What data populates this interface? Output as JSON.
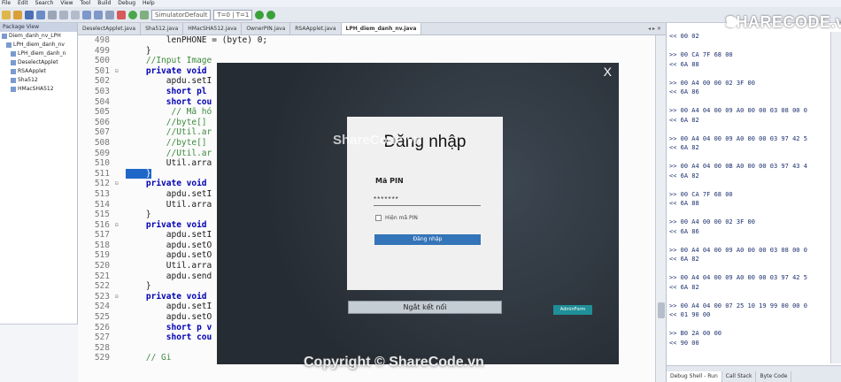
{
  "menu": [
    "File",
    "Edit",
    "Search",
    "View",
    "Tool",
    "Build",
    "Debug",
    "Help"
  ],
  "toolbar": {
    "simulator_value": "SimulatorDefault",
    "t_value": "T=0 | T=1"
  },
  "logo": {
    "text": "SHARECODE.vn"
  },
  "package_view": {
    "title": "Package View",
    "items": [
      "Diem_danh_nv_LPH",
      "LPH_diem_danh_nv",
      "LPH_diem_danh_n",
      "DeselectApplet",
      "RSAApplet",
      "Sha512",
      "HMacSHA512"
    ]
  },
  "editor": {
    "tabs": [
      "DeselectApplet.java",
      "Sha512.java",
      "HMacSHA512.java",
      "OwnerPIN.java",
      "RSAApplet.java",
      "LPH_diem_danh_nv.java"
    ],
    "active_tab_index": 5,
    "lines": [
      {
        "n": "498",
        "fold": "",
        "text": "        lenPHONE = (byte) 0;"
      },
      {
        "n": "499",
        "fold": "",
        "text": "    }"
      },
      {
        "n": "500",
        "fold": "",
        "text": "    //Input Image"
      },
      {
        "n": "501",
        "fold": "⊟",
        "text": "    private void"
      },
      {
        "n": "502",
        "fold": "",
        "text": "        apdu.setI"
      },
      {
        "n": "503",
        "fold": "",
        "text": "        short pl"
      },
      {
        "n": "504",
        "fold": "",
        "text": "        short cou"
      },
      {
        "n": "505",
        "fold": "",
        "text": "         // Mã hó"
      },
      {
        "n": "506",
        "fold": "",
        "text": "        //byte[]"
      },
      {
        "n": "507",
        "fold": "",
        "text": "        //Util.ar"
      },
      {
        "n": "508",
        "fold": "",
        "text": "        //byte[]"
      },
      {
        "n": "509",
        "fold": "",
        "text": "        //Util.ar"
      },
      {
        "n": "510",
        "fold": "",
        "text": "        Util.arra"
      },
      {
        "n": "511",
        "fold": "",
        "text": "    }"
      },
      {
        "n": "512",
        "fold": "⊟",
        "text": "    private void"
      },
      {
        "n": "513",
        "fold": "",
        "text": "        apdu.setI"
      },
      {
        "n": "514",
        "fold": "",
        "text": "        Util.arra"
      },
      {
        "n": "515",
        "fold": "",
        "text": "    }"
      },
      {
        "n": "516",
        "fold": "⊟",
        "text": "    private void"
      },
      {
        "n": "517",
        "fold": "",
        "text": "        apdu.setI"
      },
      {
        "n": "518",
        "fold": "",
        "text": "        apdu.setO"
      },
      {
        "n": "519",
        "fold": "",
        "text": "        apdu.setO"
      },
      {
        "n": "520",
        "fold": "",
        "text": "        Util.arra"
      },
      {
        "n": "521",
        "fold": "",
        "text": "        apdu.send"
      },
      {
        "n": "522",
        "fold": "",
        "text": "    }"
      },
      {
        "n": "523",
        "fold": "⊟",
        "text": "    private void"
      },
      {
        "n": "524",
        "fold": "",
        "text": "        apdu.setI"
      },
      {
        "n": "525",
        "fold": "",
        "text": "        apdu.setO"
      },
      {
        "n": "526",
        "fold": "",
        "text": "        short p v"
      },
      {
        "n": "527",
        "fold": "",
        "text": "        short cou"
      },
      {
        "n": "528",
        "fold": "",
        "text": ""
      },
      {
        "n": "529",
        "fold": "",
        "text": "    // Gi"
      }
    ]
  },
  "dialog": {
    "close": "X",
    "title": "Đăng nhập",
    "pin_label": "Mã PIN",
    "pin_value": "*******",
    "show_pin_label": "Hiện mã PIN",
    "login_button": "Đăng nhập",
    "disconnect_button": "Ngắt kết nối",
    "admin_button": "AdminForm"
  },
  "watermarks": {
    "center": "ShareCode.vn",
    "bottom": "Copyright © ShareCode.vn"
  },
  "debug": {
    "lines": [
      "<< 00 02",
      "",
      ">> 00 CA 7F 68 00",
      "<< 6A 88",
      "",
      ">> 00 A4 00 00 02 3F 00",
      "<< 6A 86",
      "",
      ">> 00 A4 04 00 09 A0 00 00 03 08 00 0",
      "<< 6A 82",
      "",
      ">> 00 A4 04 00 09 A0 00 00 03 97 42 5",
      "<< 6A 82",
      "",
      ">> 00 A4 04 00 0B A0 00 00 03 97 43 4",
      "<< 6A 82",
      "",
      ">> 00 CA 7F 68 00",
      "<< 6A 88",
      "",
      ">> 00 A4 00 00 02 3F 00",
      "<< 6A 86",
      "",
      ">> 00 A4 04 00 09 A0 00 00 03 08 00 0",
      "<< 6A 82",
      "",
      ">> 00 A4 04 00 09 A0 00 00 03 97 42 5",
      "<< 6A 82",
      "",
      ">> 00 A4 04 00 07 25 10 19 99 00 00 0",
      "<< 01 90 00",
      "",
      ">> B0 2A 00 00",
      "<< 90 00"
    ],
    "tabs": [
      "Debug Shell - Run",
      "Call Stack",
      "Byte Code"
    ]
  }
}
